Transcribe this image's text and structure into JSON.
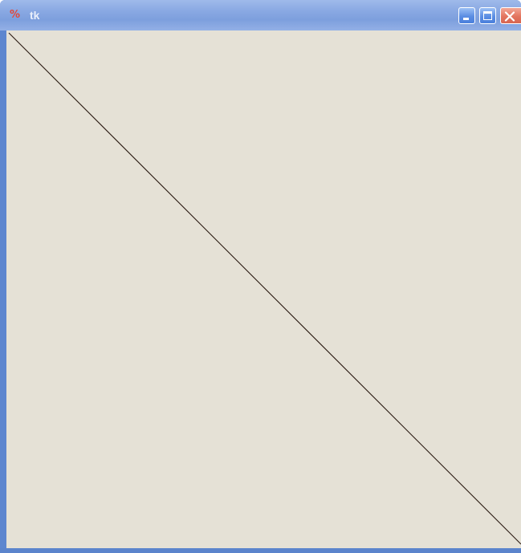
{
  "window": {
    "title": "tk",
    "app_icon": "tk-feather-icon",
    "controls": {
      "minimize_icon": "minimize-icon",
      "maximize_icon": "maximize-icon",
      "close_icon": "close-icon"
    }
  },
  "canvas": {
    "background_color": "#e5e1d6",
    "items": [
      {
        "type": "line",
        "color": "#2a1a12"
      }
    ]
  },
  "colors": {
    "titlebar": "#8aa9e3",
    "window_frame": "#5d86cf",
    "close_button": "#e3755f"
  }
}
